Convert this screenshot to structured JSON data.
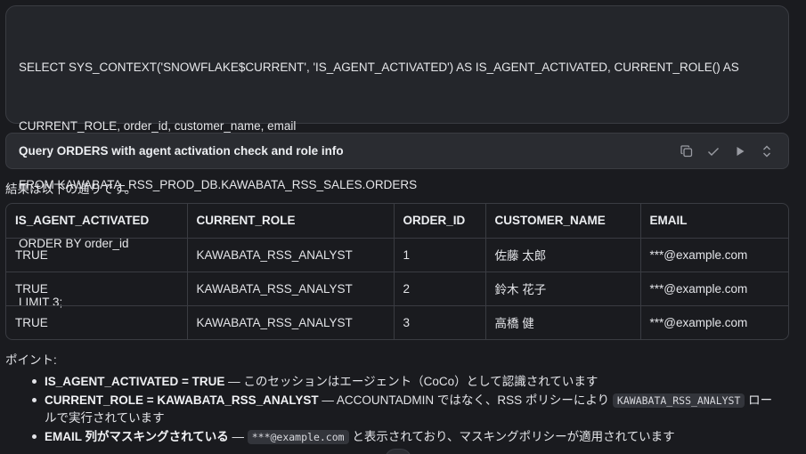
{
  "code": {
    "lines": [
      "SELECT SYS_CONTEXT('SNOWFLAKE$CURRENT', 'IS_AGENT_ACTIVATED') AS IS_AGENT_ACTIVATED, CURRENT_ROLE() AS",
      "CURRENT_ROLE, order_id, customer_name, email",
      "FROM KAWABATA_RSS_PROD_DB.KAWABATA_RSS_SALES.ORDERS",
      "ORDER BY order_id",
      "LIMIT 3;"
    ]
  },
  "query_bar": {
    "title": "Query ORDERS with agent activation check and role info",
    "icons": [
      "copy-icon",
      "check-icon",
      "play-icon",
      "expand-collapse-icon"
    ]
  },
  "result_intro": "結果は以下の通りです。",
  "table": {
    "headers": [
      "IS_AGENT_ACTIVATED",
      "CURRENT_ROLE",
      "ORDER_ID",
      "CUSTOMER_NAME",
      "EMAIL"
    ],
    "rows": [
      [
        "TRUE",
        "KAWABATA_RSS_ANALYST",
        "1",
        "佐藤 太郎",
        "***@example.com"
      ],
      [
        "TRUE",
        "KAWABATA_RSS_ANALYST",
        "2",
        "鈴木 花子",
        "***@example.com"
      ],
      [
        "TRUE",
        "KAWABATA_RSS_ANALYST",
        "3",
        "高橋 健",
        "***@example.com"
      ]
    ]
  },
  "points_label": "ポイント:",
  "bullets": [
    {
      "bold": "IS_AGENT_ACTIVATED = TRUE",
      "text": " — このセッションはエージェント（CoCo）として認識されています"
    },
    {
      "bold": "CURRENT_ROLE = KAWABATA_RSS_ANALYST",
      "text_before": " — ACCOUNTADMIN ではなく、RSS ポリシーにより ",
      "code": "KAWABATA_RSS_ANALYST",
      "text_after": " ロールで実行されています"
    },
    {
      "bold": "EMAIL 列がマスキングされている",
      "text_before": " — ",
      "code": "***@example.com",
      "text_after": " と表示されており、マスキングポリシーが適用されています"
    }
  ],
  "colors": {
    "background": "#1a1b1f",
    "panel": "#24262b",
    "border": "#3a3c42",
    "text": "#e3e4e8"
  }
}
